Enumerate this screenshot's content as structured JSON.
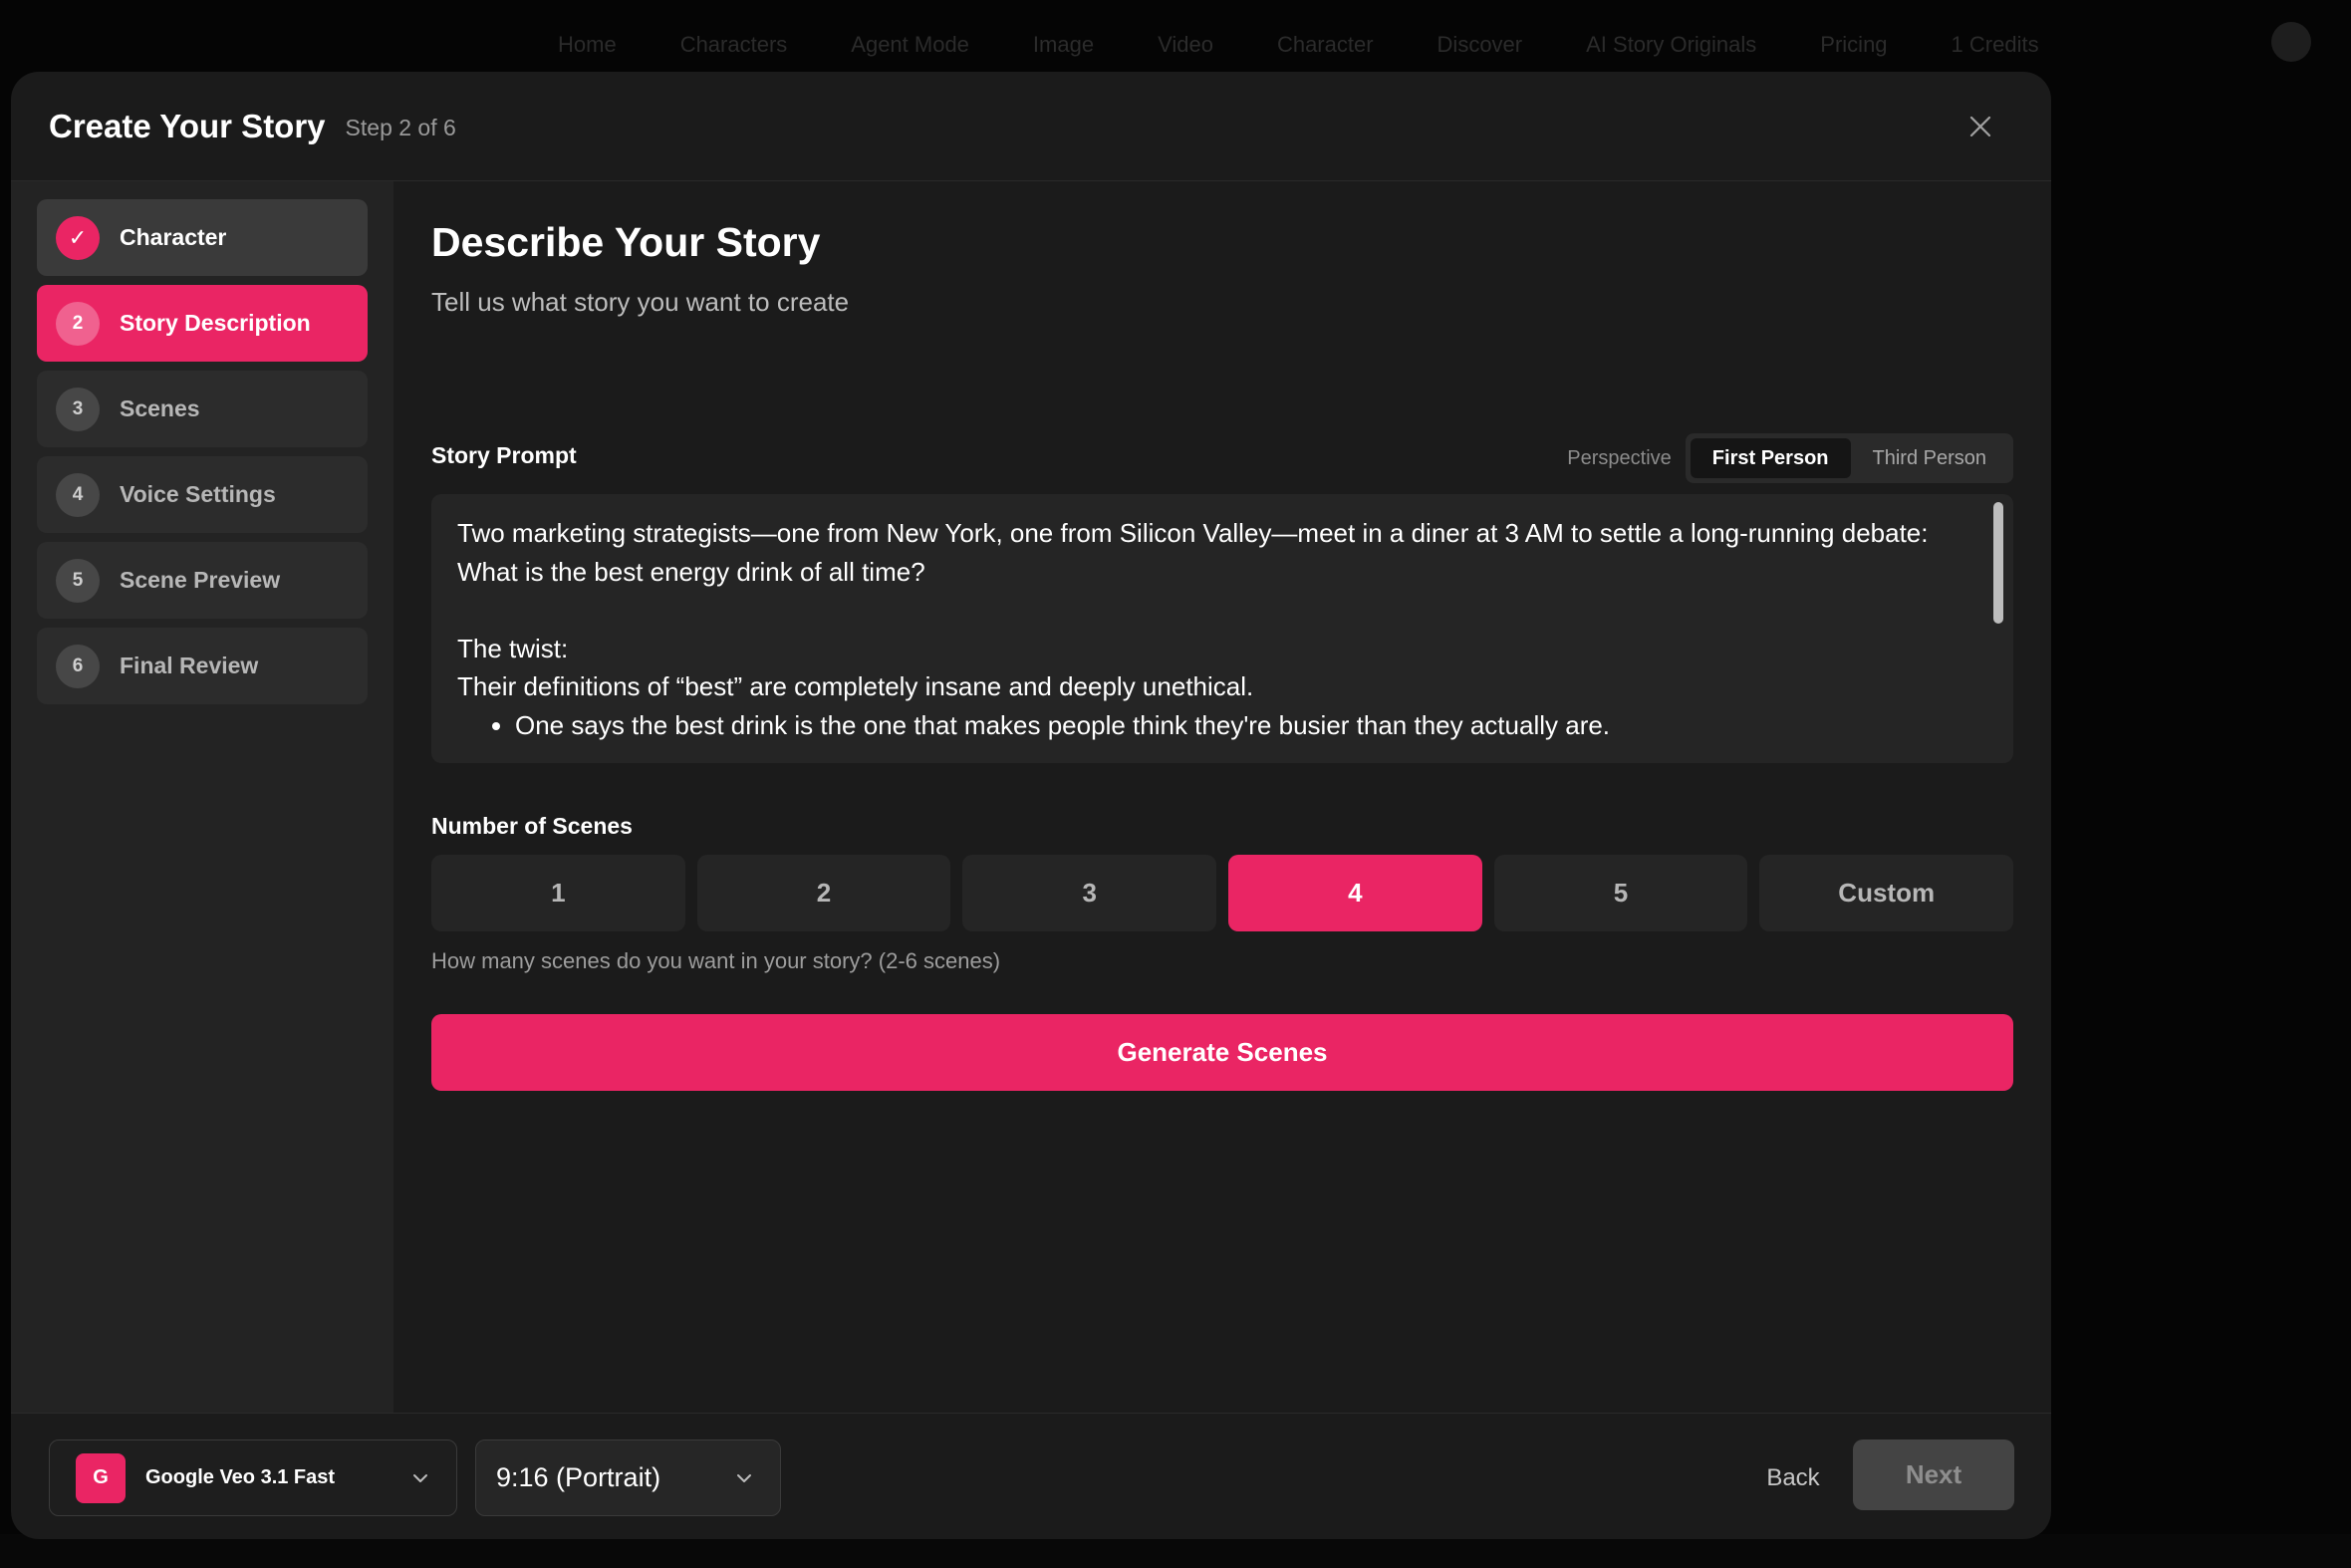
{
  "background": {
    "nav_items": [
      "Home",
      "Characters",
      "Agent Mode",
      "Image",
      "Video",
      "Character",
      "Discover",
      "AI Story Originals",
      "Pricing"
    ],
    "credits": "1 Credits"
  },
  "modal": {
    "title": "Create Your Story",
    "step_indicator": "Step 2 of 6",
    "close_icon": "close-icon"
  },
  "steps": [
    {
      "number": "✓",
      "label": "Character",
      "state": "done"
    },
    {
      "number": "2",
      "label": "Story Description",
      "state": "active"
    },
    {
      "number": "3",
      "label": "Scenes",
      "state": "pending"
    },
    {
      "number": "4",
      "label": "Voice Settings",
      "state": "pending"
    },
    {
      "number": "5",
      "label": "Scene Preview",
      "state": "pending"
    },
    {
      "number": "6",
      "label": "Final Review",
      "state": "pending"
    }
  ],
  "main": {
    "title": "Describe Your Story",
    "subtitle": "Tell us what story you want to create",
    "prompt_label": "Story Prompt",
    "perspective_label": "Perspective",
    "perspective_options": [
      "First Person",
      "Third Person"
    ],
    "perspective_selected": "First Person",
    "prompt_paragraphs": [
      "Two marketing strategists—one from New York, one from Silicon Valley—meet in a diner at 3 AM to settle a long-running debate:",
      "What is the best energy drink of all time?",
      "",
      "The twist:",
      "Their definitions of “best” are completely insane and deeply unethical."
    ],
    "prompt_bullets": [
      "One says the best drink is the one that makes people think they're busier than they actually are."
    ],
    "scenes_label": "Number of Scenes",
    "scene_options": [
      "1",
      "2",
      "3",
      "4",
      "5",
      "Custom"
    ],
    "scene_selected": "4",
    "scenes_hint": "How many scenes do you want in your story? (2-6 scenes)",
    "generate_label": "Generate Scenes"
  },
  "footer": {
    "model_logo_letter": "G",
    "model_name": "Google Veo 3.1 Fast",
    "aspect_ratio": "9:16 (Portrait)",
    "back_label": "Back",
    "next_label": "Next"
  },
  "colors": {
    "accent": "#ea2564",
    "modal_bg": "#1b1b1b",
    "sidebar_bg": "#232323"
  }
}
